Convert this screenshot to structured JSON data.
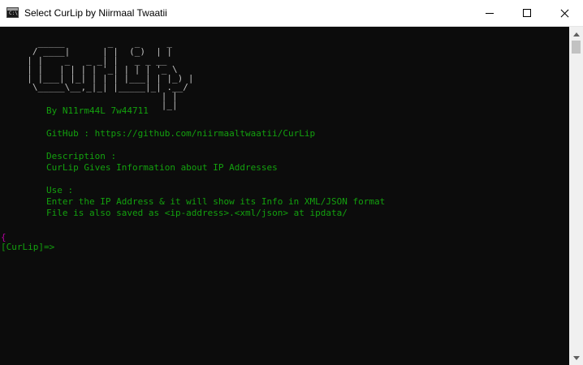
{
  "window": {
    "title": "Select CurLip by Niirmaal Twaatii",
    "icon_text": "C:\\",
    "icon": "console-icon"
  },
  "buttons": {
    "minimize": "minimize-icon",
    "maximize": "maximize-icon",
    "close": "close-icon"
  },
  "banner": {
    "lines": [
      "    _____        _    _     _",
      "   / ____|      | |  (_)  | |",
      "  | |    _   _ _| |   _ _ __",
      "  | |   | | | | '_| | | | '_ \\",
      "  | |___| |_| | | | |___| | |_) |",
      "   \\_____\\__,_|_| |_____|_| .__/",
      "                           | |",
      "                           |_|"
    ]
  },
  "info": {
    "author": "By N11rm44L 7w44711",
    "github": "GitHub : https://github.com/niirmaaltwaatii/CurLip",
    "description_label": "Description :",
    "description": "CurLip Gives Information about IP Addresses",
    "use_label": "Use :",
    "use_line1": "Enter the IP Address & it will show its Info in XML/JSON format",
    "use_line2": "File is also saved as <ip-address>.<xml/json> at ipdata/"
  },
  "prompt": {
    "marker": "{",
    "text": "[CurLip]=>"
  },
  "colors": {
    "console_bg": "#0c0c0c",
    "text_green": "#13a10e",
    "banner_gray": "#c0c0c0",
    "marker_magenta": "#b4009e",
    "titlebar_bg": "#ffffff",
    "scrollbar_bg": "#f0f0f0"
  }
}
